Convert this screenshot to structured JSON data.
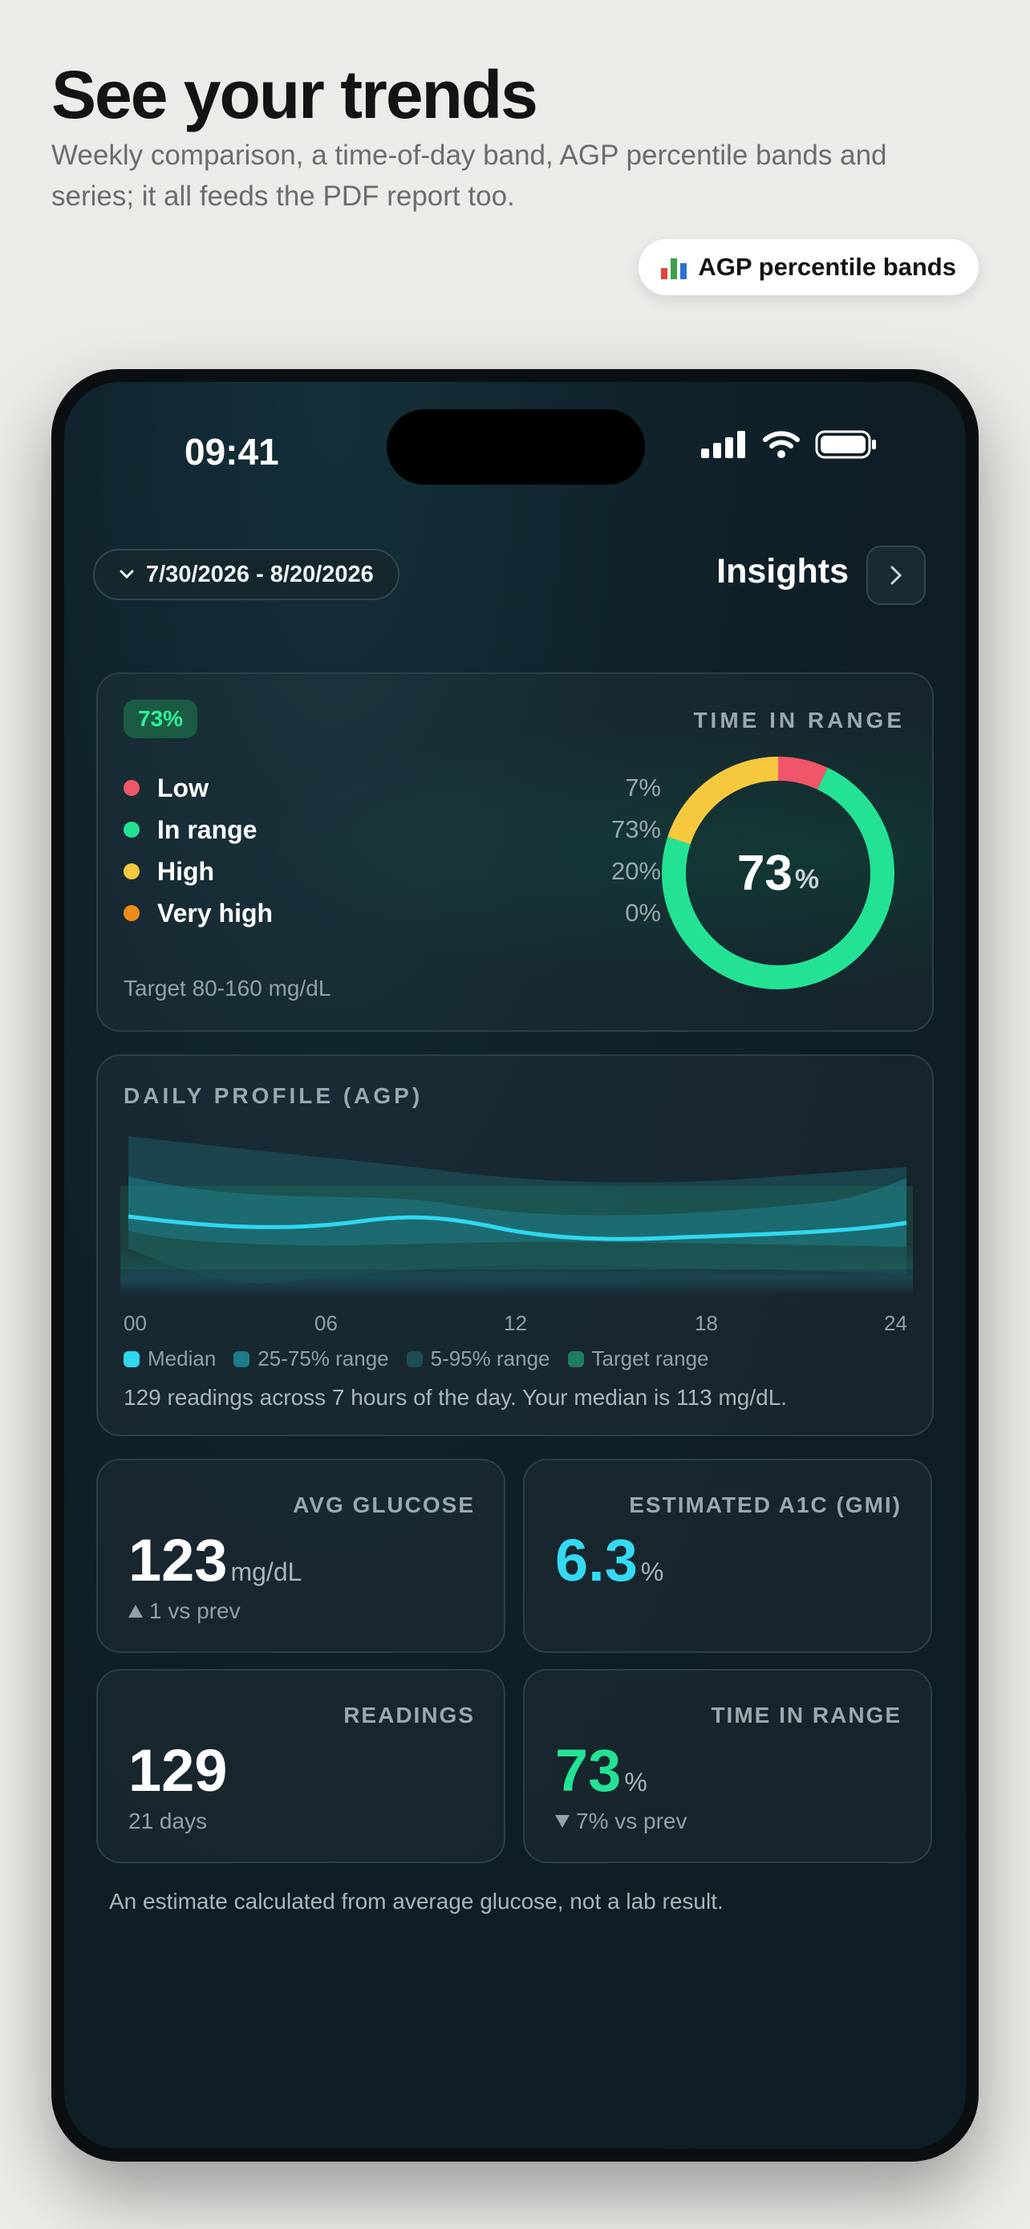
{
  "hero": {
    "title": "See your trends",
    "subtitle": "Weekly comparison, a time-of-day band, AGP percentile bands and series; it all feeds the PDF report too.",
    "chip_label": "AGP percentile bands",
    "chip_icon": "bar-chart-icon"
  },
  "status_bar": {
    "time": "09:41",
    "icons": [
      "cellular-signal-icon",
      "wifi-icon",
      "battery-icon"
    ]
  },
  "header": {
    "date_range": "7/30/2026 - 8/20/2026",
    "title": "Insights"
  },
  "time_in_range": {
    "badge": "73%",
    "label": "TIME IN RANGE",
    "rows": [
      {
        "name": "Low",
        "value": "7%",
        "color": "#f0566a"
      },
      {
        "name": "In range",
        "value": "73%",
        "color": "#24e294"
      },
      {
        "name": "High",
        "value": "20%",
        "color": "#f6c83e"
      },
      {
        "name": "Very high",
        "value": "0%",
        "color": "#f08a1c"
      }
    ],
    "target": "Target 80-160 mg/dL",
    "center_value": "73",
    "center_unit": "%"
  },
  "agp": {
    "label": "DAILY PROFILE (AGP)",
    "ticks": [
      "00",
      "06",
      "12",
      "18",
      "24"
    ],
    "legend": [
      {
        "name": "Median",
        "color": "#2fd8ef"
      },
      {
        "name": "25-75% range",
        "color": "#1e7c87"
      },
      {
        "name": "5-95% range",
        "color": "#1c4d57"
      },
      {
        "name": "Target range",
        "color": "#1f7c5c"
      }
    ],
    "note": "129 readings across 7 hours of the day. Your median is 113 mg/dL."
  },
  "stats": {
    "avg_glucose": {
      "label": "AVG GLUCOSE",
      "value": "123",
      "unit": "mg/dL",
      "sub": "1 vs prev"
    },
    "a1c": {
      "label": "ESTIMATED A1C (GMI)",
      "value": "6.3",
      "unit": "%",
      "color": "#35d9f2"
    },
    "readings": {
      "label": "READINGS",
      "value": "129",
      "sub": "21 days"
    },
    "tir": {
      "label": "TIME IN RANGE",
      "value": "73",
      "unit": "%",
      "sub": "7% vs prev",
      "color": "#24e294"
    }
  },
  "footnote": "An estimate calculated from average glucose, not a lab result."
}
